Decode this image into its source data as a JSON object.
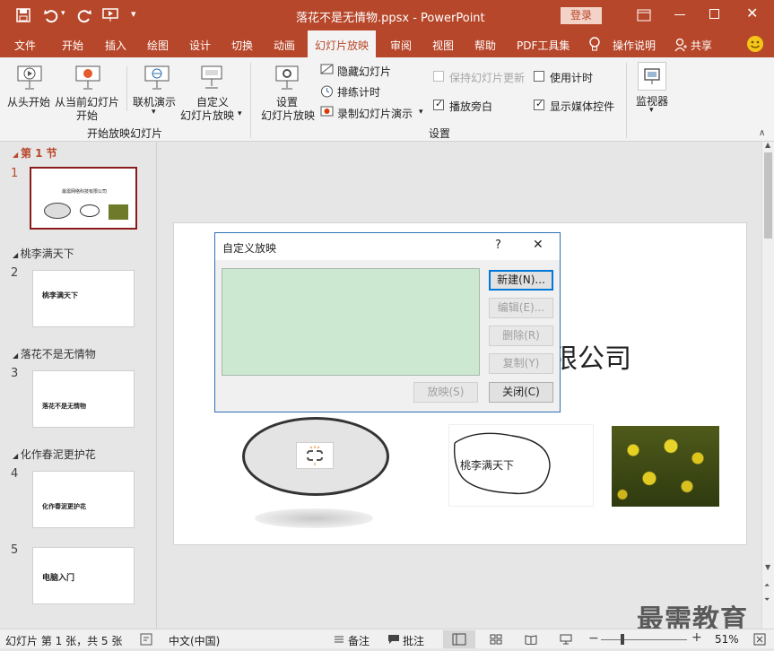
{
  "window": {
    "title": "落花不是无情物.ppsx  -  PowerPoint",
    "login_label": "登录",
    "qat_save_icon": "save-icon",
    "qat_undo_icon": "undo-icon",
    "qat_redo_icon": "redo-icon",
    "qat_present_icon": "start-slideshow-icon",
    "qat_more": "▾"
  },
  "tabs": [
    "文件",
    "开始",
    "插入",
    "绘图",
    "设计",
    "切换",
    "动画",
    "幻灯片放映",
    "审阅",
    "视图",
    "帮助",
    "PDF工具集"
  ],
  "tab_extra": {
    "tell_me": "操作说明",
    "share": "共享"
  },
  "active_tab": "幻灯片放映",
  "ribbon": {
    "from_start": "从头开始",
    "from_current_l1": "从当前幻灯片",
    "from_current_l2": "开始",
    "online_l1": "联机演示",
    "custom_l1": "自定义",
    "custom_l2": "幻灯片放映",
    "group_start": "开始放映幻灯片",
    "setup_l1": "设置",
    "setup_l2": "幻灯片放映",
    "hide_slide": "隐藏幻灯片",
    "rehearse": "排练计时",
    "record": "录制幻灯片演示",
    "keep_updated": "保持幻灯片更新",
    "use_timings": "使用计时",
    "play_narrations": "播放旁白",
    "show_media_controls": "显示媒体控件",
    "group_setup": "设置",
    "monitor": "监视器"
  },
  "thumbnails": {
    "sections": [
      {
        "name": "第 1 节"
      },
      {
        "name": "桃李满天下"
      },
      {
        "name": "落花不是无情物"
      },
      {
        "name": "化作春泥更护花"
      }
    ],
    "slides": [
      {
        "num": "1",
        "text": "最需网络科技有限公司"
      },
      {
        "num": "2",
        "text": "桃李满天下"
      },
      {
        "num": "3",
        "text": "落花不是无情物"
      },
      {
        "num": "4",
        "text": "化作春泥更护花"
      },
      {
        "num": "5",
        "text": "电脑入门"
      }
    ]
  },
  "slide": {
    "title_visible_fragment": "限公司",
    "callout_text": "桃李满天下"
  },
  "dialog": {
    "title": "自定义放映",
    "help": "?",
    "close_x": "✕",
    "btn_new": "新建(N)...",
    "btn_edit": "编辑(E)...",
    "btn_delete": "删除(R)",
    "btn_copy": "复制(Y)",
    "btn_show": "放映(S)",
    "btn_close": "关闭(C)"
  },
  "status": {
    "slide_info": "幻灯片 第 1 张，共 5 张",
    "language": "中文(中国)",
    "notes": "备注",
    "comments": "批注",
    "zoom": "51%",
    "zoom_level": 0.51
  },
  "watermark": "最需教育",
  "colors": {
    "accent": "#b7472a",
    "dialog_list": "#cde8d1"
  }
}
